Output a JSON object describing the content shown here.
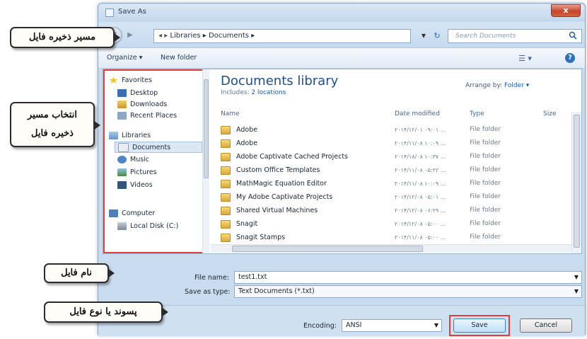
{
  "window": {
    "title": "Save As",
    "close": "x"
  },
  "address": {
    "path_1": "Libraries",
    "path_2": "Documents",
    "search_placeholder": "Search Documents"
  },
  "toolbar": {
    "organize": "Organize ▾",
    "new_folder": "New folder"
  },
  "nav": {
    "favorites": "Favorites",
    "desktop": "Desktop",
    "downloads": "Downloads",
    "recent": "Recent Places",
    "libraries": "Libraries",
    "documents": "Documents",
    "music": "Music",
    "pictures": "Pictures",
    "videos": "Videos",
    "computer": "Computer",
    "local_disk": "Local Disk (C:)"
  },
  "library": {
    "title": "Documents library",
    "includes_label": "Includes:",
    "includes_link": "2 locations",
    "arrange_label": "Arrange by:",
    "arrange_value": "Folder ▾"
  },
  "columns": {
    "name": "Name",
    "date": "Date modified",
    "type": "Type",
    "size": "Size"
  },
  "files": [
    {
      "name": "Adobe",
      "date": "۲۰۱۴/۱۲/۰۱ ۰۹:۰۱ ...",
      "type": "File folder"
    },
    {
      "name": "Adobe",
      "date": "۲۰۱۴/۱۱/۰۸ ۱۰:۰۹ ...",
      "type": "File folder"
    },
    {
      "name": "Adobe Captivate Cached Projects",
      "date": "۲۰۱۴/۱۸/۰۸ ۱۰:۳۷ ...",
      "type": "File folder"
    },
    {
      "name": "Custom Office Templates",
      "date": "۲۰۱۴/۱۱/۰۸ ۰۵:۲۲ ...",
      "type": "File folder"
    },
    {
      "name": "MathMagic Equation Editor",
      "date": "۲۰۱۴/۱۱/۰۸ ۱۰:۰۹ ...",
      "type": "File folder"
    },
    {
      "name": "My Adobe Captivate Projects",
      "date": "۲۰۱۴/۱۲/۰۸ ۰۵:۰۱ ...",
      "type": "File folder"
    },
    {
      "name": "Shared Virtual Machines",
      "date": "۲۰۱۴/۱۲/۰۸ ۰۶:۲۹ ...",
      "type": "File folder"
    },
    {
      "name": "Snagit",
      "date": "۲۰۱۴/۱۲/۰۸ ۰۵:۰۰ ...",
      "type": "File folder"
    },
    {
      "name": "Snagit Stamps",
      "date": "۲۰۱۴/۱۱/۰۸ ۰۵:۰۰ ...",
      "type": "File folder"
    }
  ],
  "form": {
    "file_name_label": "File name:",
    "file_name_value": "test1.txt",
    "save_type_label": "Save as type:",
    "save_type_value": "Text Documents (*.txt)",
    "encoding_label": "Encoding:",
    "encoding_value": "ANSI",
    "save": "Save",
    "cancel": "Cancel"
  },
  "callouts": {
    "save_path": "مسیر ذخیره فایل",
    "choose_path": "انتخاب مسیر ذخیره فایل",
    "file_name": "نام فایل",
    "extension": "پسوند یا نوع فایل"
  },
  "colors": {
    "accent_red": "#e0403a",
    "link_blue": "#1c5bb0",
    "window_frame": "#c9dcef"
  }
}
